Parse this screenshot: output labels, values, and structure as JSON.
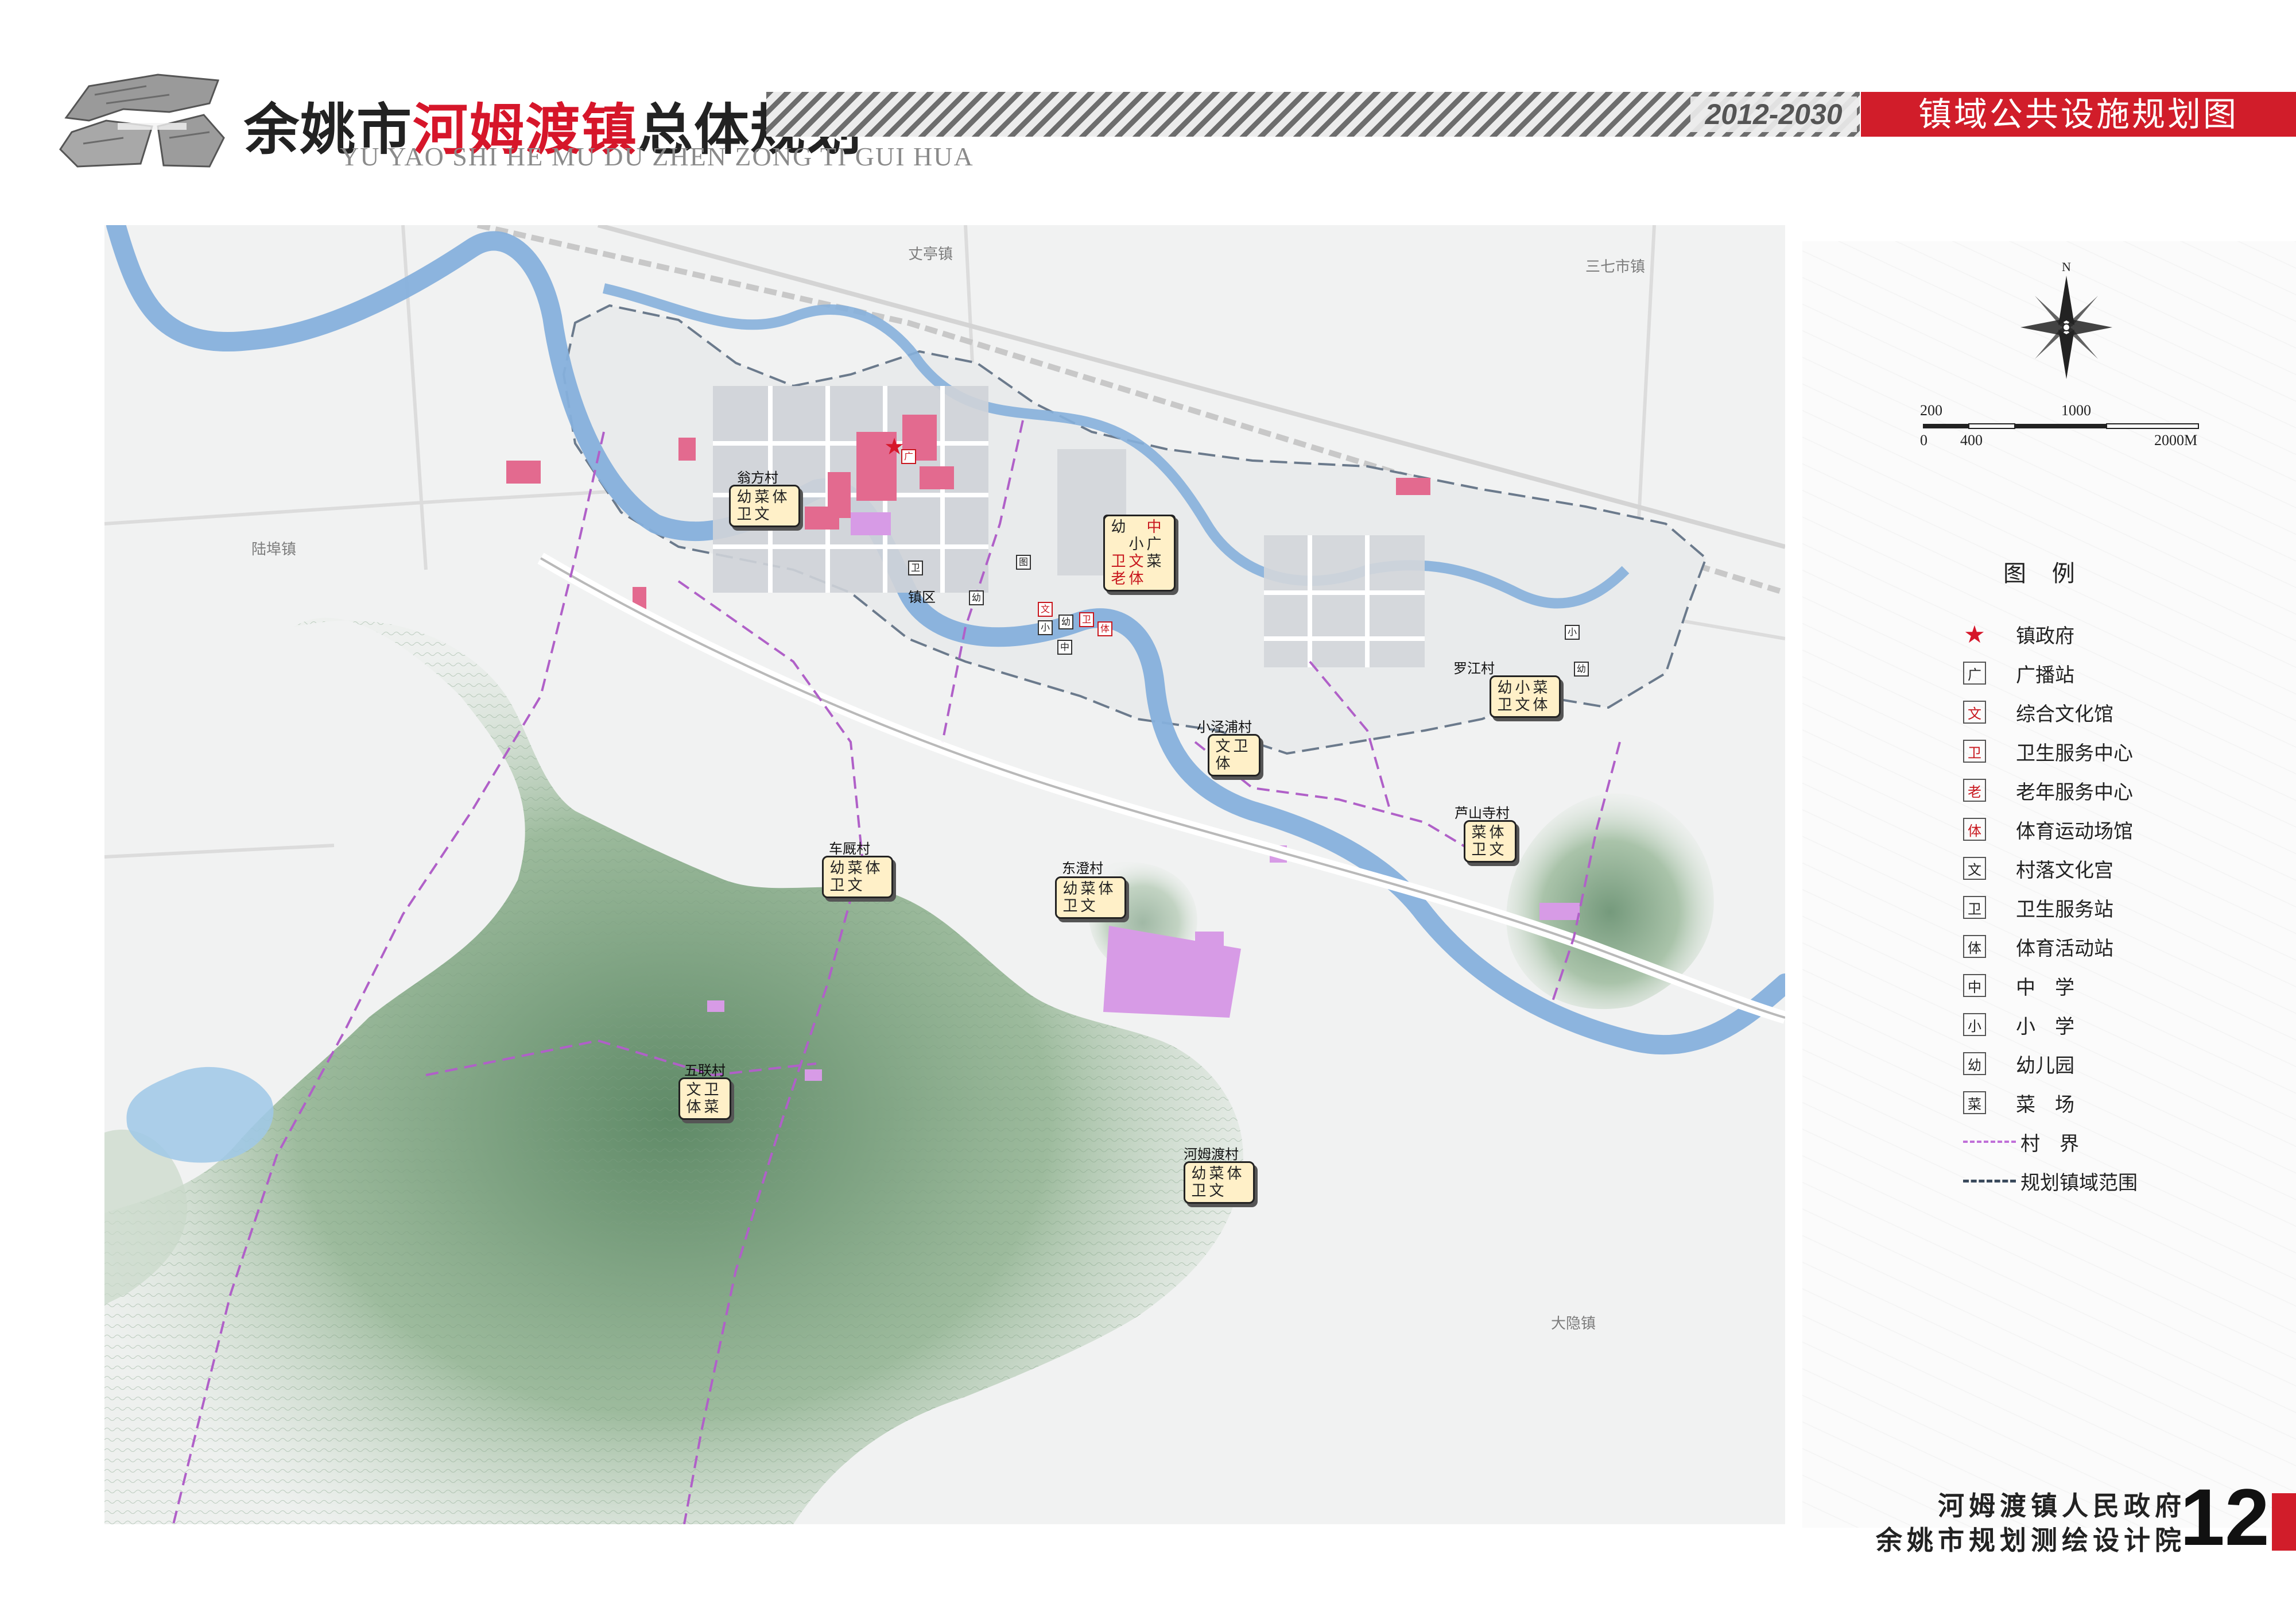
{
  "header": {
    "title_prefix": "余姚市",
    "title_highlight": "河姆渡镇",
    "title_suffix": "总体规划",
    "title_en": "YU YAO SHI HE MU DU ZHEN ZONG TI GUI HUA",
    "years": "2012-2030",
    "map_title": "镇域公共设施规划图"
  },
  "map": {
    "places": {
      "zhangting": "丈亭镇",
      "sanqishi": "三七市镇",
      "luhuo": "陆埠镇",
      "dayin": "大隐镇"
    },
    "town": {
      "label": "镇区",
      "badge": [
        "幼",
        "中",
        "小",
        "文",
        "广",
        "卫",
        "老",
        "体",
        "菜"
      ]
    },
    "villages": [
      {
        "name": "翁方村",
        "badge": [
          "幼",
          "菜",
          "体",
          "卫",
          "文"
        ]
      },
      {
        "name": "罗江村",
        "badge": [
          "幼",
          "小",
          "菜",
          "卫",
          "文",
          "体"
        ]
      },
      {
        "name": "小泾浦村",
        "badge": [
          "文",
          "卫",
          "体"
        ]
      },
      {
        "name": "芦山寺村",
        "badge": [
          "菜",
          "体",
          "卫",
          "文"
        ]
      },
      {
        "name": "车厩村",
        "badge": [
          "幼",
          "菜",
          "体",
          "卫",
          "文"
        ]
      },
      {
        "name": "东澄村",
        "badge": [
          "幼",
          "菜",
          "体",
          "卫",
          "文"
        ]
      },
      {
        "name": "五联村",
        "badge": [
          "文",
          "卫",
          "体",
          "菜"
        ]
      },
      {
        "name": "河姆渡村",
        "badge": [
          "幼",
          "菜",
          "体",
          "卫",
          "文"
        ]
      }
    ],
    "facility_markers": [
      "卫",
      "图",
      "广",
      "幼",
      "文",
      "小",
      "中",
      "幼",
      "卫",
      "体",
      "小",
      "幼"
    ]
  },
  "scale": {
    "top_labels": [
      "200",
      "1000"
    ],
    "bottom_labels": [
      "0",
      "400",
      "2000M"
    ],
    "north": "N"
  },
  "legend": {
    "title": "图 例",
    "items": [
      {
        "symbol": "★",
        "label": "镇政府",
        "kind": "star"
      },
      {
        "symbol": "广",
        "label": "广播站",
        "kind": "black"
      },
      {
        "symbol": "文",
        "label": "综合文化馆",
        "kind": "red"
      },
      {
        "symbol": "卫",
        "label": "卫生服务中心",
        "kind": "red"
      },
      {
        "symbol": "老",
        "label": "老年服务中心",
        "kind": "red"
      },
      {
        "symbol": "体",
        "label": "体育运动场馆",
        "kind": "red"
      },
      {
        "symbol": "文",
        "label": "村落文化宫",
        "kind": "black"
      },
      {
        "symbol": "卫",
        "label": "卫生服务站",
        "kind": "black"
      },
      {
        "symbol": "体",
        "label": "体育活动站",
        "kind": "black"
      },
      {
        "symbol": "中",
        "label": "中　学",
        "kind": "black"
      },
      {
        "symbol": "小",
        "label": "小　学",
        "kind": "black"
      },
      {
        "symbol": "幼",
        "label": "幼儿园",
        "kind": "black"
      },
      {
        "symbol": "菜",
        "label": "菜　场",
        "kind": "black"
      },
      {
        "symbol": "",
        "label": "村　界",
        "kind": "dash-pink"
      },
      {
        "symbol": "",
        "label": "规划镇域范围",
        "kind": "dash-dark"
      }
    ]
  },
  "footer": {
    "org_line1": "河姆渡镇人民政府",
    "org_line2": "余姚市规划测绘设计院",
    "page": "12"
  },
  "colors": {
    "accent_red": "#d11d2a",
    "river": "#7fa8d6",
    "hills": "#8fb08f",
    "village_boundary": "#b060c8",
    "public_land": "#e36a8f",
    "sports_land": "#d79be6"
  }
}
